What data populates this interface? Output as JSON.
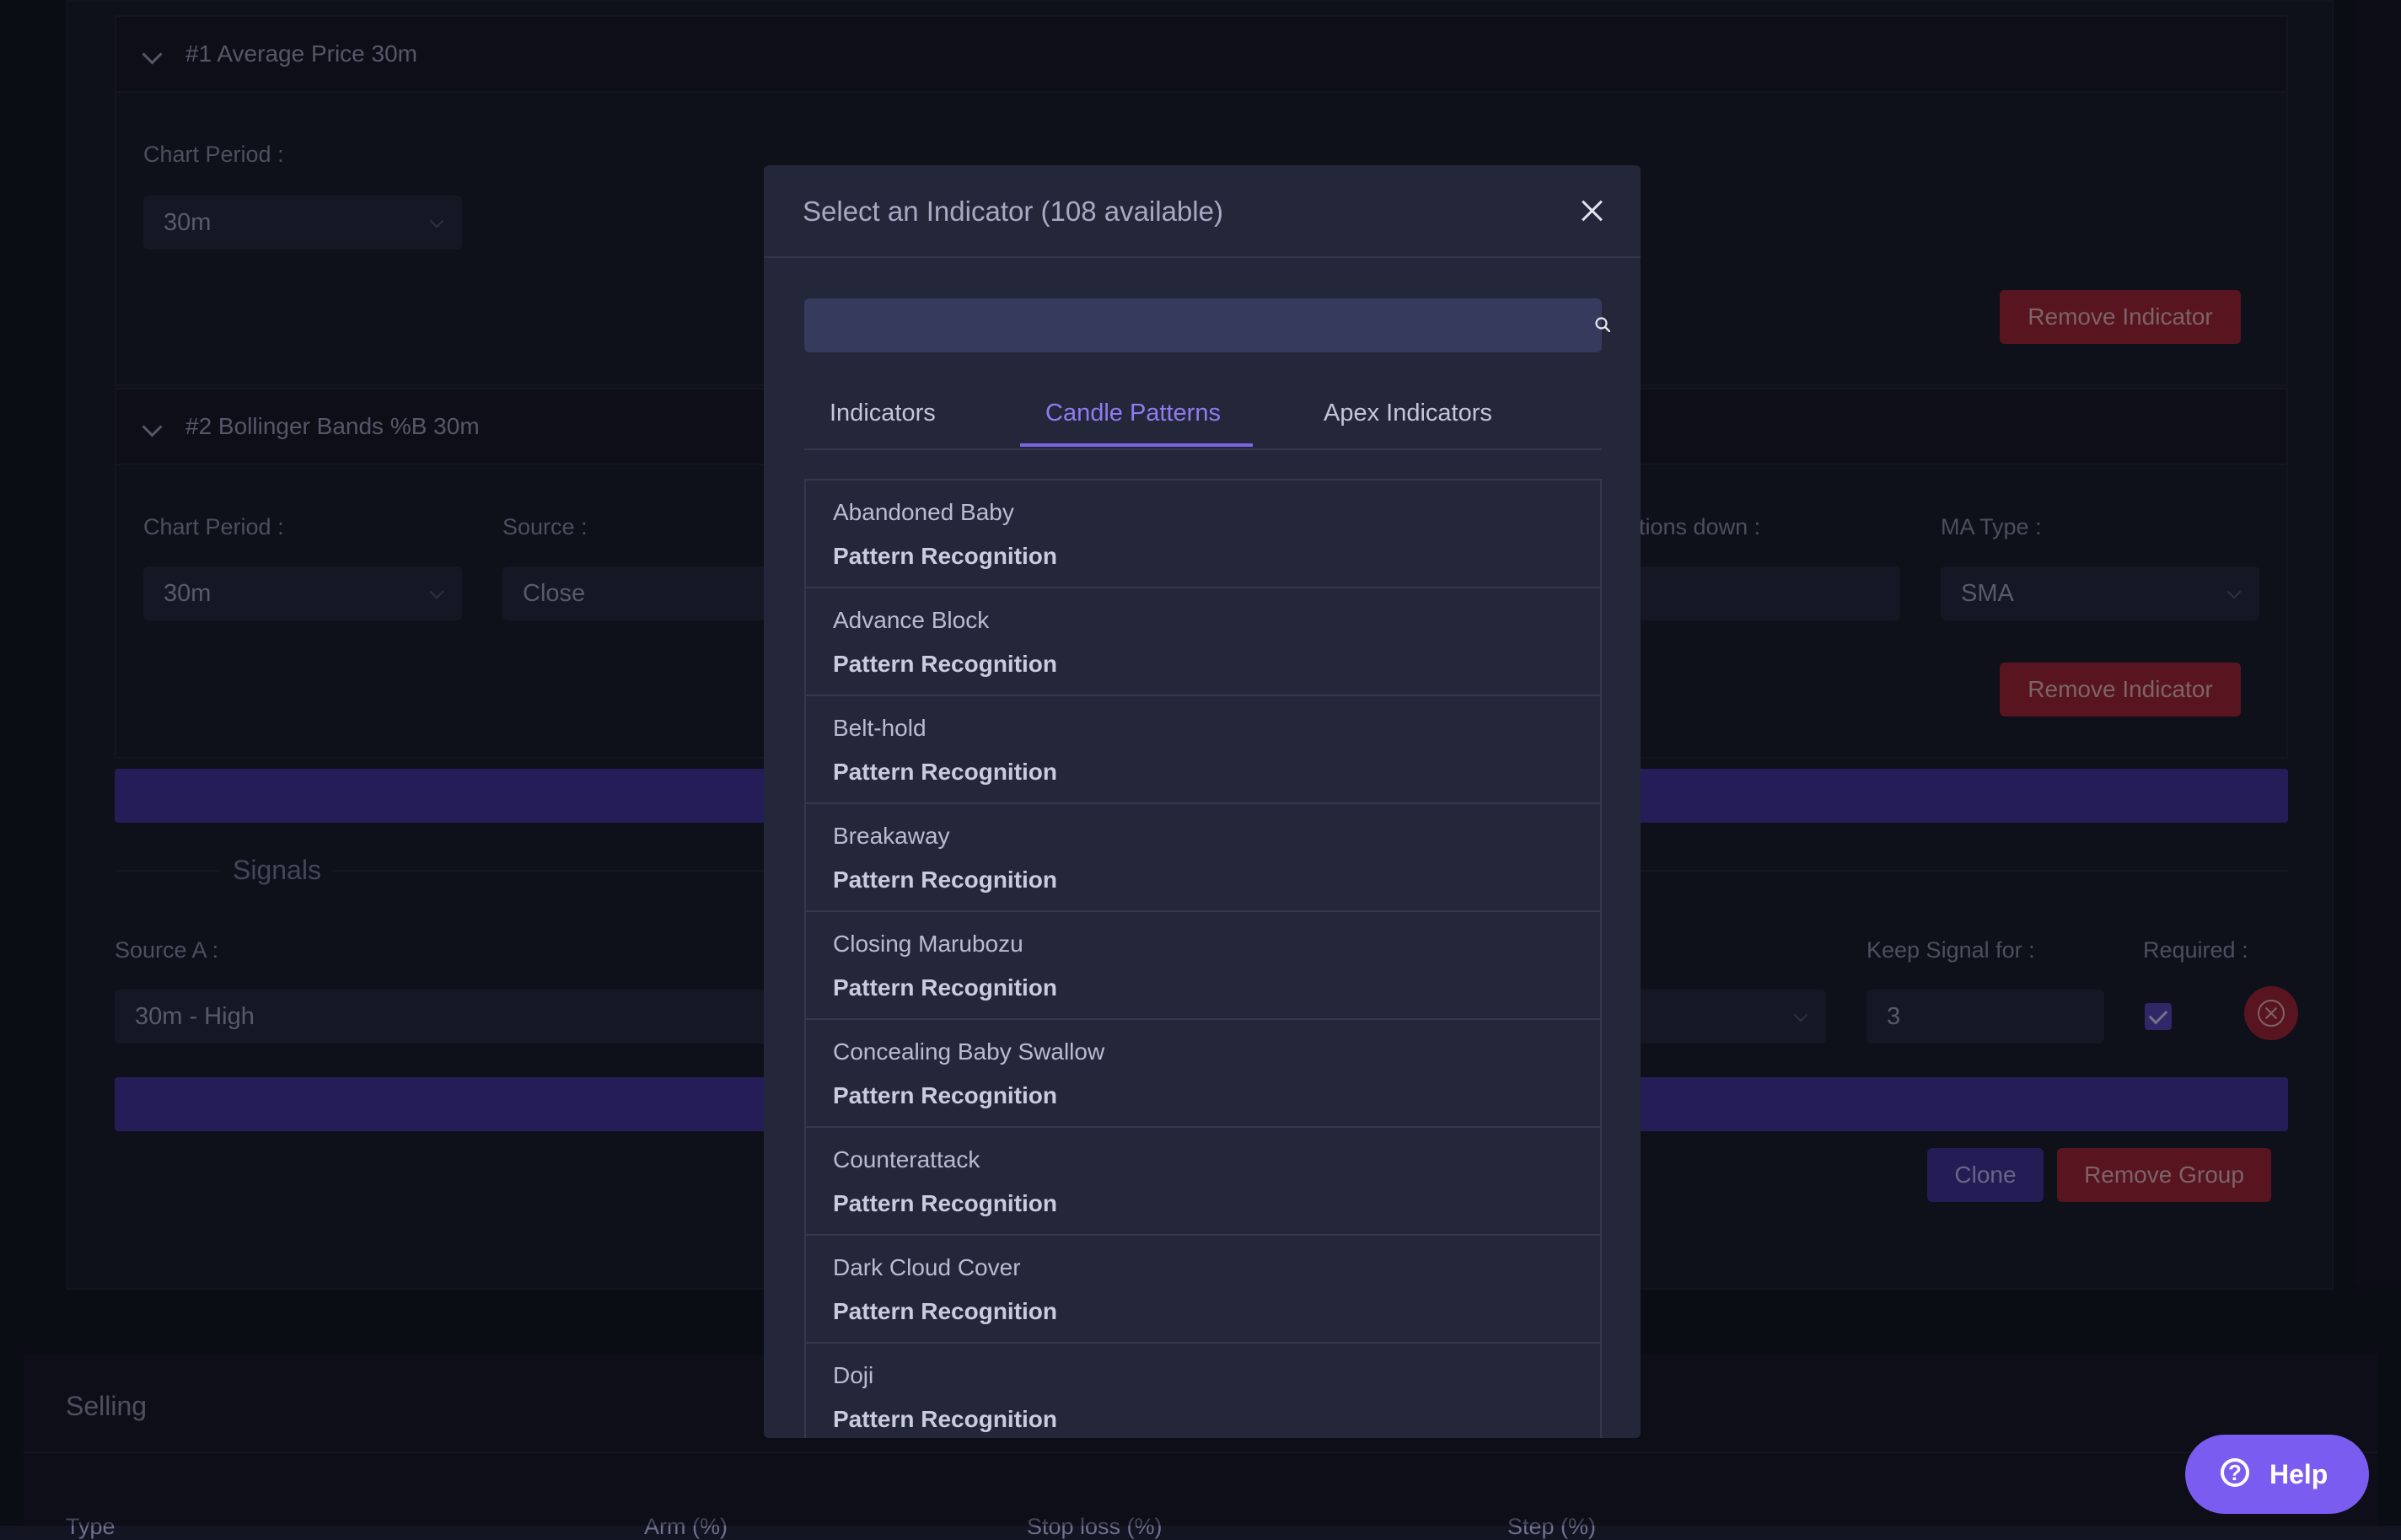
{
  "background": {
    "indicator1": {
      "title": "#1 Average Price 30m",
      "chart_period_label": "Chart Period",
      "chart_period_value": "30m",
      "remove_label": "Remove Indicator"
    },
    "indicator2": {
      "title": "#2 Bollinger Bands %B 30m",
      "chart_period_label": "Chart Period",
      "chart_period_value": "30m",
      "source_label": "Source",
      "source_value": "Close",
      "deviations_label": "tions down",
      "ma_type_label": "MA Type",
      "ma_type_value": "SMA",
      "remove_label": "Remove Indicator"
    },
    "signals": {
      "title": "Signals",
      "source_a_label": "Source A",
      "source_a_value": "30m - High",
      "keep_signal_label": "Keep Signal for",
      "keep_signal_value": "3",
      "required_label": "Required"
    },
    "clone_label": "Clone",
    "remove_group_label": "Remove Group",
    "selling": {
      "title": "Selling",
      "col1": "Type",
      "col2": "Arm (%)",
      "col3": "Stop loss (%)",
      "col4": "Step (%)"
    }
  },
  "modal": {
    "title": "Select an Indicator (108 available)",
    "search": {
      "value": "",
      "placeholder": ""
    },
    "tabs": [
      {
        "label": "Indicators",
        "active": false
      },
      {
        "label": "Candle Patterns",
        "active": true
      },
      {
        "label": "Apex Indicators",
        "active": false
      }
    ],
    "items": [
      {
        "name": "Abandoned Baby",
        "category": "Pattern Recognition"
      },
      {
        "name": "Advance Block",
        "category": "Pattern Recognition"
      },
      {
        "name": "Belt-hold",
        "category": "Pattern Recognition"
      },
      {
        "name": "Breakaway",
        "category": "Pattern Recognition"
      },
      {
        "name": "Closing Marubozu",
        "category": "Pattern Recognition"
      },
      {
        "name": "Concealing Baby Swallow",
        "category": "Pattern Recognition"
      },
      {
        "name": "Counterattack",
        "category": "Pattern Recognition"
      },
      {
        "name": "Dark Cloud Cover",
        "category": "Pattern Recognition"
      },
      {
        "name": "Doji",
        "category": "Pattern Recognition"
      }
    ]
  },
  "help": {
    "label": "Help",
    "icon": "question-circle-icon"
  },
  "colors": {
    "accent": "#7b65e6",
    "danger": "#8e2234",
    "modal_bg": "#24273a",
    "page_bg": "#131523"
  }
}
